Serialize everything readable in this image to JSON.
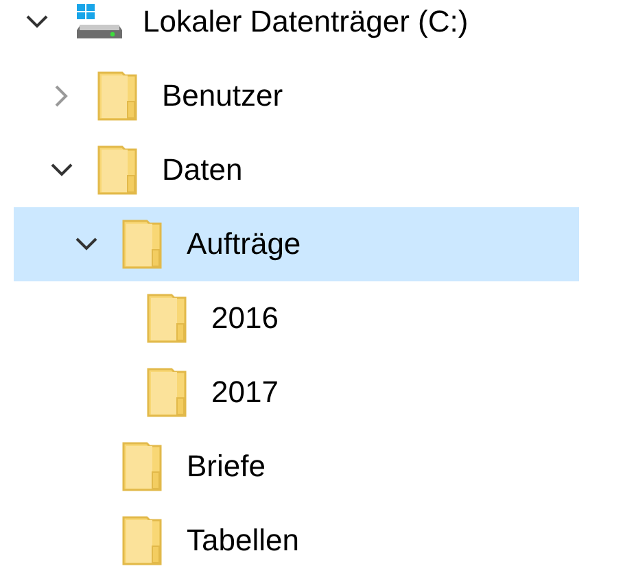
{
  "tree": [
    {
      "kind": "drive",
      "label": "Lokaler Datenträger (C:)",
      "expanded": true,
      "selected": false,
      "children": [
        {
          "kind": "folder",
          "label": "Benutzer",
          "expanded": false,
          "selected": false
        },
        {
          "kind": "folder",
          "label": "Daten",
          "expanded": true,
          "selected": false,
          "children": [
            {
              "kind": "folder",
              "label": "Aufträge",
              "expanded": true,
              "selected": true,
              "children": [
                {
                  "kind": "folder",
                  "label": "2016",
                  "selected": false
                },
                {
                  "kind": "folder",
                  "label": "2017",
                  "selected": false
                }
              ]
            },
            {
              "kind": "folder",
              "label": "Briefe",
              "selected": false
            },
            {
              "kind": "folder",
              "label": "Tabellen",
              "selected": false
            }
          ]
        }
      ]
    }
  ]
}
